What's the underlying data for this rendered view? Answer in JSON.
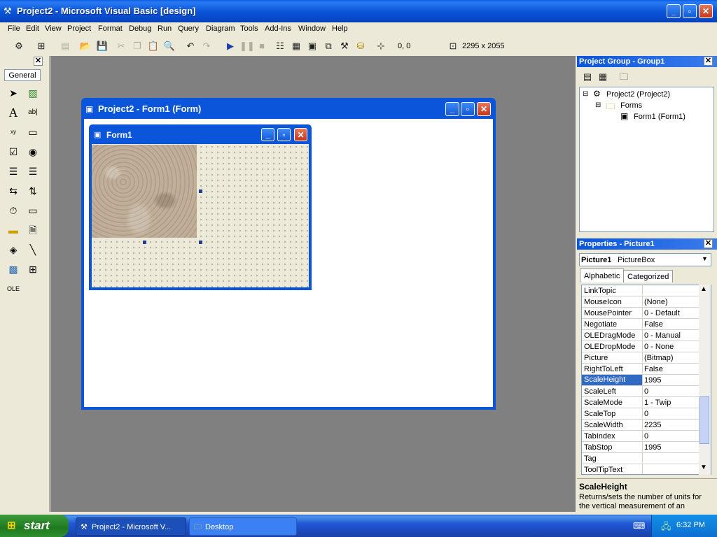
{
  "app": {
    "title": "Project2 - Microsoft Visual Basic [design]"
  },
  "menu": [
    "File",
    "Edit",
    "View",
    "Project",
    "Format",
    "Debug",
    "Run",
    "Query",
    "Diagram",
    "Tools",
    "Add-Ins",
    "Window",
    "Help"
  ],
  "toolbar": {
    "coords": "0, 0",
    "size": "2295 x 2055"
  },
  "toolbox": {
    "tab_label": "General"
  },
  "mdi_window": {
    "title": "Project2 - Form1 (Form)"
  },
  "form1": {
    "title": "Form1"
  },
  "project_group": {
    "title": "Project Group - Group1",
    "project": "Project2 (Project2)",
    "folder": "Forms",
    "form": "Form1 (Form1)"
  },
  "properties": {
    "title": "Properties - Picture1",
    "object_name": "Picture1",
    "object_type": "PictureBox",
    "tabs": [
      "Alphabetic",
      "Categorized"
    ],
    "selected": "ScaleHeight",
    "rows": [
      {
        "name": "LinkTopic",
        "value": ""
      },
      {
        "name": "MouseIcon",
        "value": "(None)"
      },
      {
        "name": "MousePointer",
        "value": "0 - Default"
      },
      {
        "name": "Negotiate",
        "value": "False"
      },
      {
        "name": "OLEDragMode",
        "value": "0 - Manual"
      },
      {
        "name": "OLEDropMode",
        "value": "0 - None"
      },
      {
        "name": "Picture",
        "value": "(Bitmap)"
      },
      {
        "name": "RightToLeft",
        "value": "False"
      },
      {
        "name": "ScaleHeight",
        "value": "1995"
      },
      {
        "name": "ScaleLeft",
        "value": "0"
      },
      {
        "name": "ScaleMode",
        "value": "1 - Twip"
      },
      {
        "name": "ScaleTop",
        "value": "0"
      },
      {
        "name": "ScaleWidth",
        "value": "2235"
      },
      {
        "name": "TabIndex",
        "value": "0"
      },
      {
        "name": "TabStop",
        "value": "1995"
      },
      {
        "name": "Tag",
        "value": ""
      },
      {
        "name": "ToolTipText",
        "value": ""
      }
    ],
    "description_title": "ScaleHeight",
    "description_text": "Returns/sets the number of units for the vertical measurement of an"
  },
  "taskbar": {
    "start": "start",
    "items": [
      "Project2 - Microsoft V...",
      "Desktop"
    ],
    "clock": "6:32 PM"
  }
}
